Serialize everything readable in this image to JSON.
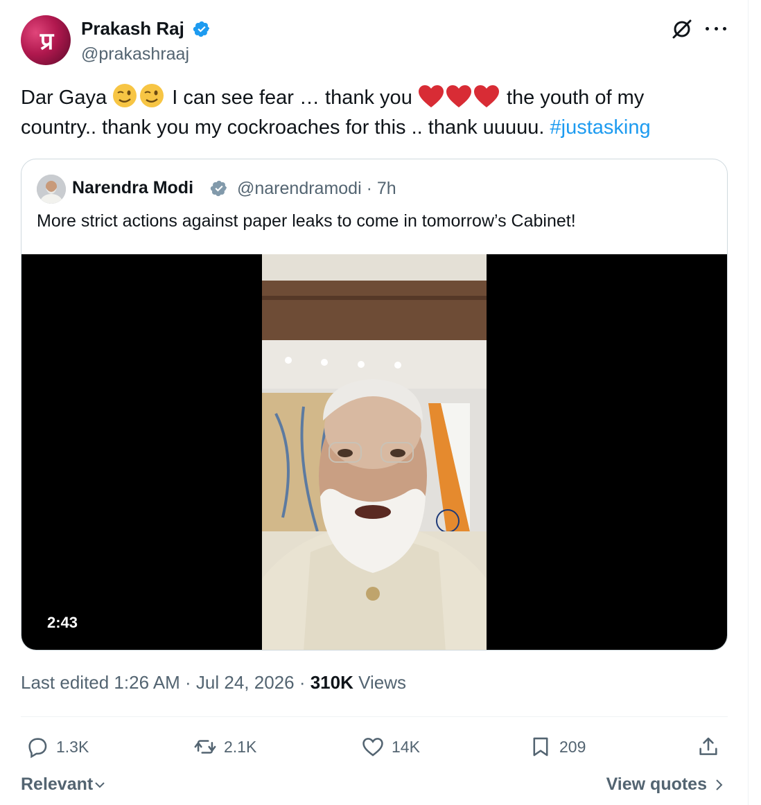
{
  "author": {
    "name": "Prakash Raj",
    "handle": "@prakashraaj",
    "avatar_monogram": "प्र",
    "verified_icon": "verified-badge-icon"
  },
  "header_icons": [
    "grok-icon",
    "more-icon"
  ],
  "tweet": {
    "text_part1": "Dar Gaya",
    "text_part2": "I can see fear … thank you",
    "text_part3": "the youth of my country.. thank you my cockroaches for this .. thank uuuuu.",
    "hashtag": "#justasking",
    "emojis": [
      "winking-face",
      "winking-face",
      "red-heart",
      "red-heart",
      "red-heart"
    ]
  },
  "quoted": {
    "name": "Narendra Modi",
    "handle_time": "@narendramodi · 7h",
    "text": "More strict actions against paper leaks to come in tomorrow’s Cabinet!",
    "video_duration": "2:43"
  },
  "meta": {
    "edited_label": "Last edited 1:26 AM · Jul 24, 2026 · ",
    "views_count": "310K",
    "views_label": "Views"
  },
  "actions": {
    "replies": "1.3K",
    "reposts": "2.1K",
    "likes": "14K",
    "bookmarks": "209"
  },
  "footer": {
    "sort_label": "Relevant",
    "view_quotes_label": "View quotes"
  },
  "colors": {
    "link": "#1d9bf0",
    "secondary_text": "#536471",
    "verified_blue": "#1d9bf0",
    "verified_gray": "#829aab"
  }
}
